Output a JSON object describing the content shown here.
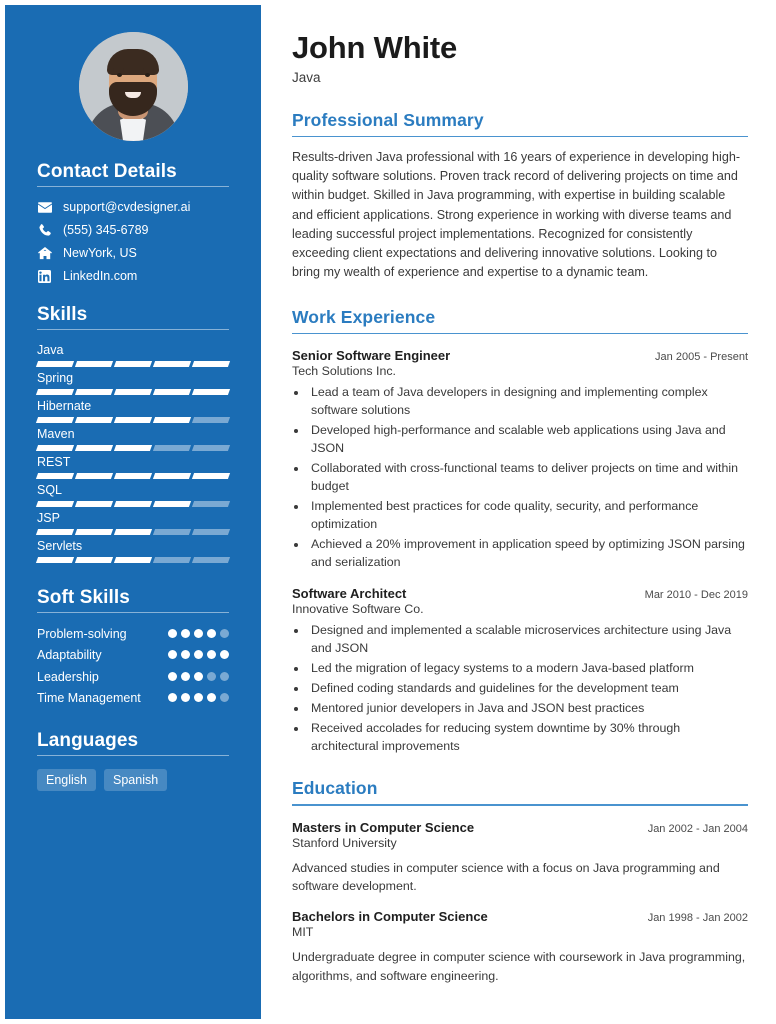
{
  "theme": {
    "sidebar_bg": "#1a6cb3",
    "accent": "#2b7cc0",
    "rule": "#4a93cf",
    "text": "#333333"
  },
  "sidebar": {
    "avatar_alt": "profile-photo",
    "contact": {
      "heading": "Contact Details",
      "items": [
        {
          "icon": "envelope-icon",
          "value": "support@cvdesigner.ai"
        },
        {
          "icon": "phone-icon",
          "value": "(555) 345-6789"
        },
        {
          "icon": "home-icon",
          "value": "NewYork, US"
        },
        {
          "icon": "linkedin-icon",
          "value": "LinkedIn.com"
        }
      ]
    },
    "skills": {
      "heading": "Skills",
      "max": 5,
      "items": [
        {
          "name": "Java",
          "level": 5
        },
        {
          "name": "Spring",
          "level": 5
        },
        {
          "name": "Hibernate",
          "level": 4
        },
        {
          "name": "Maven",
          "level": 3
        },
        {
          "name": "REST",
          "level": 5
        },
        {
          "name": "SQL",
          "level": 4
        },
        {
          "name": "JSP",
          "level": 3
        },
        {
          "name": "Servlets",
          "level": 3
        }
      ]
    },
    "soft_skills": {
      "heading": "Soft Skills",
      "max": 5,
      "items": [
        {
          "name": "Problem-solving",
          "level": 4
        },
        {
          "name": "Adaptability",
          "level": 5
        },
        {
          "name": "Leadership",
          "level": 3
        },
        {
          "name": "Time Management",
          "level": 4
        }
      ]
    },
    "languages": {
      "heading": "Languages",
      "items": [
        "English",
        "Spanish"
      ]
    }
  },
  "main": {
    "name": "John White",
    "role": "Java",
    "summary_section": {
      "heading": "Professional Summary",
      "text": "Results-driven Java professional with 16 years of experience in developing high-quality software solutions. Proven track record of delivering projects on time and within budget. Skilled in Java programming, with expertise in building scalable and efficient applications. Strong experience in working with diverse teams and leading successful project implementations. Recognized for consistently exceeding client expectations and delivering innovative solutions. Looking to bring my wealth of experience and expertise to a dynamic team."
    },
    "work_section": {
      "heading": "Work Experience",
      "entries": [
        {
          "title": "Senior Software Engineer",
          "date": "Jan 2005 - Present",
          "org": "Tech Solutions Inc.",
          "bullets": [
            "Lead a team of Java developers in designing and implementing complex software solutions",
            "Developed high-performance and scalable web applications using Java and JSON",
            "Collaborated with cross-functional teams to deliver projects on time and within budget",
            "Implemented best practices for code quality, security, and performance optimization",
            "Achieved a 20% improvement in application speed by optimizing JSON parsing and serialization"
          ]
        },
        {
          "title": "Software Architect",
          "date": "Mar 2010 - Dec 2019",
          "org": "Innovative Software Co.",
          "bullets": [
            "Designed and implemented a scalable microservices architecture using Java and JSON",
            "Led the migration of legacy systems to a modern Java-based platform",
            "Defined coding standards and guidelines for the development team",
            "Mentored junior developers in Java and JSON best practices",
            "Received accolades for reducing system downtime by 30% through architectural improvements"
          ]
        }
      ]
    },
    "education_section": {
      "heading": "Education",
      "entries": [
        {
          "title": "Masters in Computer Science",
          "date": "Jan 2002 - Jan 2004",
          "org": "Stanford University",
          "desc": "Advanced studies in computer science with a focus on Java programming and software development."
        },
        {
          "title": "Bachelors in Computer Science",
          "date": "Jan 1998 - Jan 2002",
          "org": "MIT",
          "desc": "Undergraduate degree in computer science with coursework in Java programming, algorithms, and software engineering."
        }
      ]
    }
  }
}
